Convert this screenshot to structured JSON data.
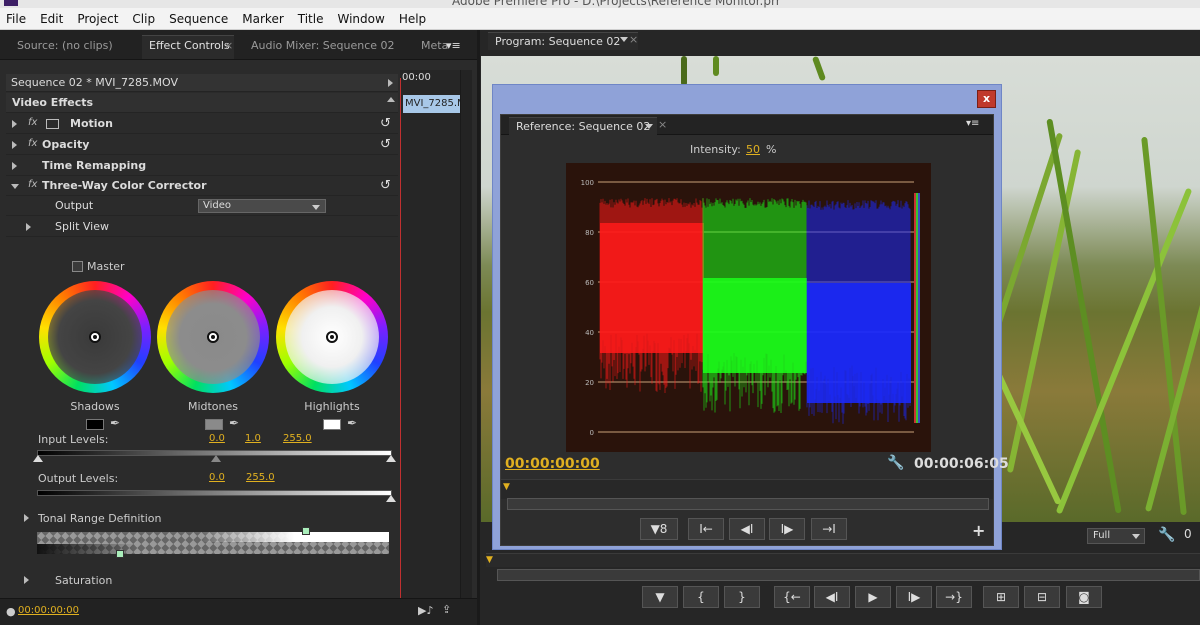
{
  "app": {
    "title": "Adobe Premiere Pro - D:\\Projects\\Reference Monitor.prr",
    "menu": [
      "File",
      "Edit",
      "Project",
      "Clip",
      "Sequence",
      "Marker",
      "Title",
      "Window",
      "Help"
    ]
  },
  "left_panel": {
    "tabs": [
      "Source: (no clips)",
      "Effect Controls",
      "Audio Mixer: Sequence 02",
      "Meta"
    ],
    "tab_close": "×",
    "tab_menu": "▾≡",
    "sequence_clip": "Sequence 02 * MVI_7285.MOV",
    "timeline_time": "00:00",
    "timeline_clip": "MVI_7285.M",
    "video_effects": "Video Effects",
    "effects": [
      {
        "label": "Motion",
        "has_reset": true
      },
      {
        "label": "Opacity",
        "has_reset": true
      },
      {
        "label": "Time Remapping",
        "has_reset": false
      },
      {
        "label": "Three-Way Color Corrector",
        "has_reset": true
      }
    ],
    "output_label": "Output",
    "output_value": "Video",
    "split_view": "Split View",
    "master": "Master",
    "wheels": [
      "Shadows",
      "Midtones",
      "Highlights"
    ],
    "input_levels": {
      "label": "Input Levels:",
      "values": [
        "0.0",
        "1.0",
        "255.0"
      ]
    },
    "output_levels": {
      "label": "Output Levels:",
      "values": [
        "0.0",
        "255.0"
      ]
    },
    "tonal_range": "Tonal Range Definition",
    "saturation": "Saturation",
    "timecode": "00:00:00:00"
  },
  "program": {
    "tab": "Program: Sequence 02",
    "zoom": "Full"
  },
  "reference": {
    "tab": "Reference: Sequence 02",
    "intensity_label": "Intensity:",
    "intensity_value": "50",
    "intensity_unit": "%",
    "timecode_left": "00:00:00:00",
    "timecode_right": "00:00:06:05",
    "close": "x",
    "plus": "+"
  },
  "scope": {
    "y_ticks": [
      "100",
      "80",
      "60",
      "40",
      "20",
      "0"
    ],
    "colors": {
      "red": "#ff1a1a",
      "green": "#1aff1a",
      "blue": "#1a2aff"
    }
  },
  "colors": {
    "accent": "#e0b020",
    "popup_border": "#8fa2d8"
  }
}
